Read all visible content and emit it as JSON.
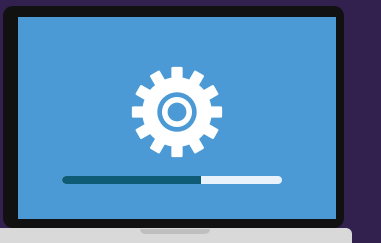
{
  "colors": {
    "background": "#32214f",
    "frame": "#111111",
    "screen": "#4b9ad6",
    "gear": "#ffffff",
    "progress_track": "#e9f2fa",
    "progress_fill": "#0f5a74",
    "base": "#d9d9d9",
    "notch": "#bfbfbf"
  },
  "icons": {
    "main": "gear-icon"
  },
  "progress": {
    "value_fraction": 0.63
  }
}
